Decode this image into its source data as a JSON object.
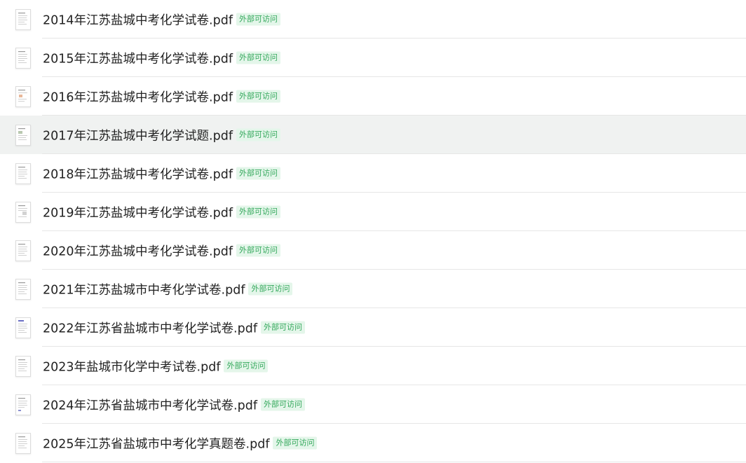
{
  "badge_label": "外部可访问",
  "files": [
    {
      "name": "2014年江苏盐城中考化学试卷.pdf"
    },
    {
      "name": "2015年江苏盐城中考化学试卷.pdf"
    },
    {
      "name": "2016年江苏盐城中考化学试卷.pdf"
    },
    {
      "name": "2017年江苏盐城中考化学试题.pdf"
    },
    {
      "name": "2018年江苏盐城中考化学试卷.pdf"
    },
    {
      "name": "2019年江苏盐城中考化学试卷.pdf"
    },
    {
      "name": "2020年江苏盐城中考化学试卷.pdf"
    },
    {
      "name": "2021年江苏盐城市中考化学试卷.pdf"
    },
    {
      "name": "2022年江苏省盐城市中考化学试卷.pdf"
    },
    {
      "name": "2023年盐城市化学中考试卷.pdf"
    },
    {
      "name": "2024年江苏省盐城市中考化学试卷.pdf"
    },
    {
      "name": "2025年江苏省盐城市中考化学真题卷.pdf"
    }
  ],
  "colors": {
    "badge_text": "#33a85b",
    "badge_bg": "#e4f6ea",
    "highlight_row_bg": "#f0f2f1"
  },
  "icons": {
    "file_thumb": "pdf-thumbnail-icon"
  }
}
